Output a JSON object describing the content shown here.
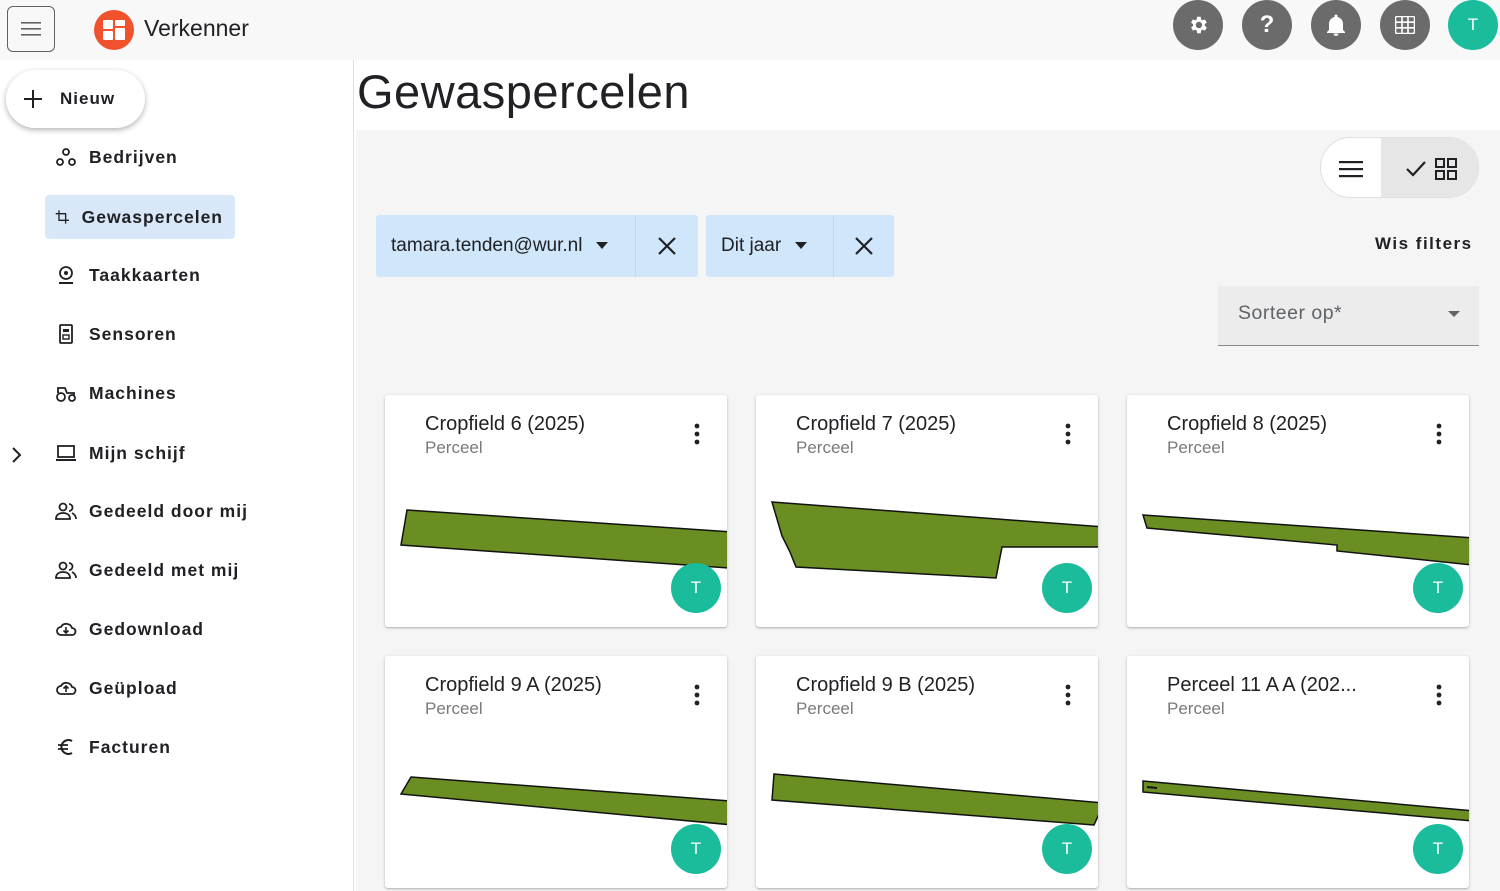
{
  "app": {
    "title": "Verkenner"
  },
  "topbar": {
    "settings_icon": "gear-icon",
    "help_label": "?",
    "notifications_icon": "bell-icon",
    "apps_icon": "grid-icon",
    "avatar_initial": "T"
  },
  "sidebar": {
    "new_label": "Nieuw",
    "items": [
      {
        "label": "Bedrijven",
        "icon": "companies-icon"
      },
      {
        "label": "Gewaspercelen",
        "icon": "crop-icon",
        "active": true
      },
      {
        "label": "Taakkaarten",
        "icon": "task-map-icon"
      },
      {
        "label": "Sensoren",
        "icon": "sensor-icon"
      },
      {
        "label": "Machines",
        "icon": "tractor-icon"
      },
      {
        "label": "Mijn schijf",
        "icon": "laptop-icon",
        "expandable": true
      },
      {
        "label": "Gedeeld door mij",
        "icon": "people-icon"
      },
      {
        "label": "Gedeeld met mij",
        "icon": "people-icon"
      },
      {
        "label": "Gedownload",
        "icon": "cloud-download-icon"
      },
      {
        "label": "Geüpload",
        "icon": "cloud-upload-icon"
      },
      {
        "label": "Facturen",
        "icon": "euro-icon"
      }
    ]
  },
  "main": {
    "title": "Gewaspercelen",
    "filters": [
      {
        "label": "tamara.tenden@wur.nl"
      },
      {
        "label": "Dit jaar"
      }
    ],
    "clear_filters": "Wis filters",
    "sort_placeholder": "Sorteer op*",
    "cards": [
      {
        "title": "Cropfield 6 (2025)",
        "subtitle": "Perceel",
        "avatar": "T"
      },
      {
        "title": "Cropfield 7 (2025)",
        "subtitle": "Perceel",
        "avatar": "T"
      },
      {
        "title": "Cropfield 8 (2025)",
        "subtitle": "Perceel",
        "avatar": "T"
      },
      {
        "title": "Cropfield 9 A (2025)",
        "subtitle": "Perceel",
        "avatar": "T"
      },
      {
        "title": "Cropfield 9 B (2025)",
        "subtitle": "Perceel",
        "avatar": "T"
      },
      {
        "title": "Perceel 11 A A (202...",
        "subtitle": "Perceel",
        "avatar": "T"
      }
    ]
  },
  "colors": {
    "field_fill": "#6b8e23",
    "avatar": "#1abc9c",
    "chip_bg": "#cfe6fb",
    "active_nav_bg": "#d8e8f8",
    "logo": "#f0522d"
  }
}
